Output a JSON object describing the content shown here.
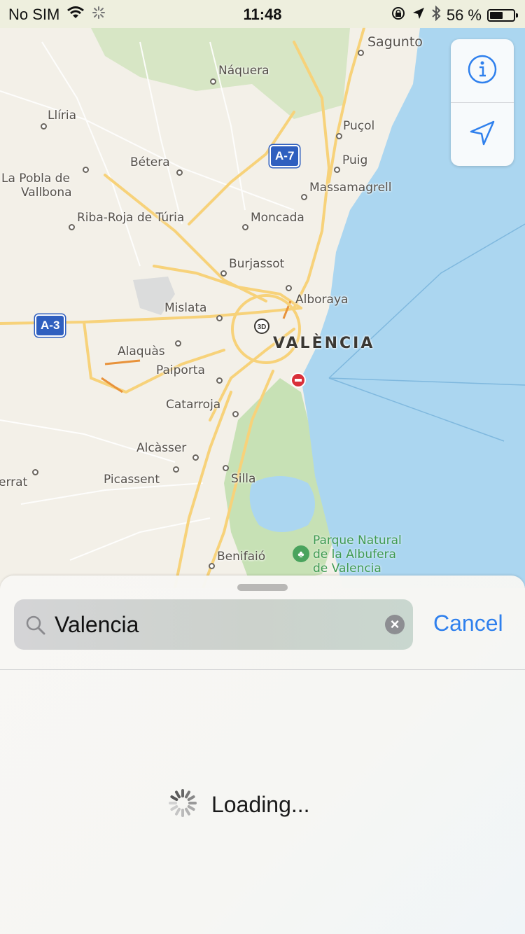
{
  "status_bar": {
    "carrier": "No SIM",
    "time": "11:48",
    "battery_percent": "56 %",
    "battery_level": 0.56
  },
  "map": {
    "city": "VALÈNCIA",
    "labels": [
      "Sagunto",
      "Náquera",
      "Llíria",
      "Puçol",
      "Bétera",
      "Puig",
      "La Pobla de",
      "Vallbona",
      "Massamagrell",
      "Riba-Roja de Túria",
      "Moncada",
      "Burjassot",
      "Alboraya",
      "Mislata",
      "Alaquàs",
      "Paiporta",
      "Catarroja",
      "Alcàsser",
      "Picassent",
      "Silla",
      "errat",
      "Benifaió"
    ],
    "park": "Parque Natural\nde la Albufera\nde Valencia",
    "shields": [
      "A-7",
      "A-3"
    ],
    "badge_3d": "3D",
    "colors": {
      "land": "#f3f0e8",
      "water": "#abd6f0",
      "park": "#c7e1b5",
      "road_major": "#f7d27a",
      "road_minor": "#ffffff"
    }
  },
  "controls": {
    "info_icon": "info-icon",
    "location_icon": "location-arrow-icon"
  },
  "search": {
    "value": "Valencia",
    "cancel_label": "Cancel"
  },
  "loading": {
    "text": "Loading..."
  },
  "accent_color": "#2f80ed"
}
